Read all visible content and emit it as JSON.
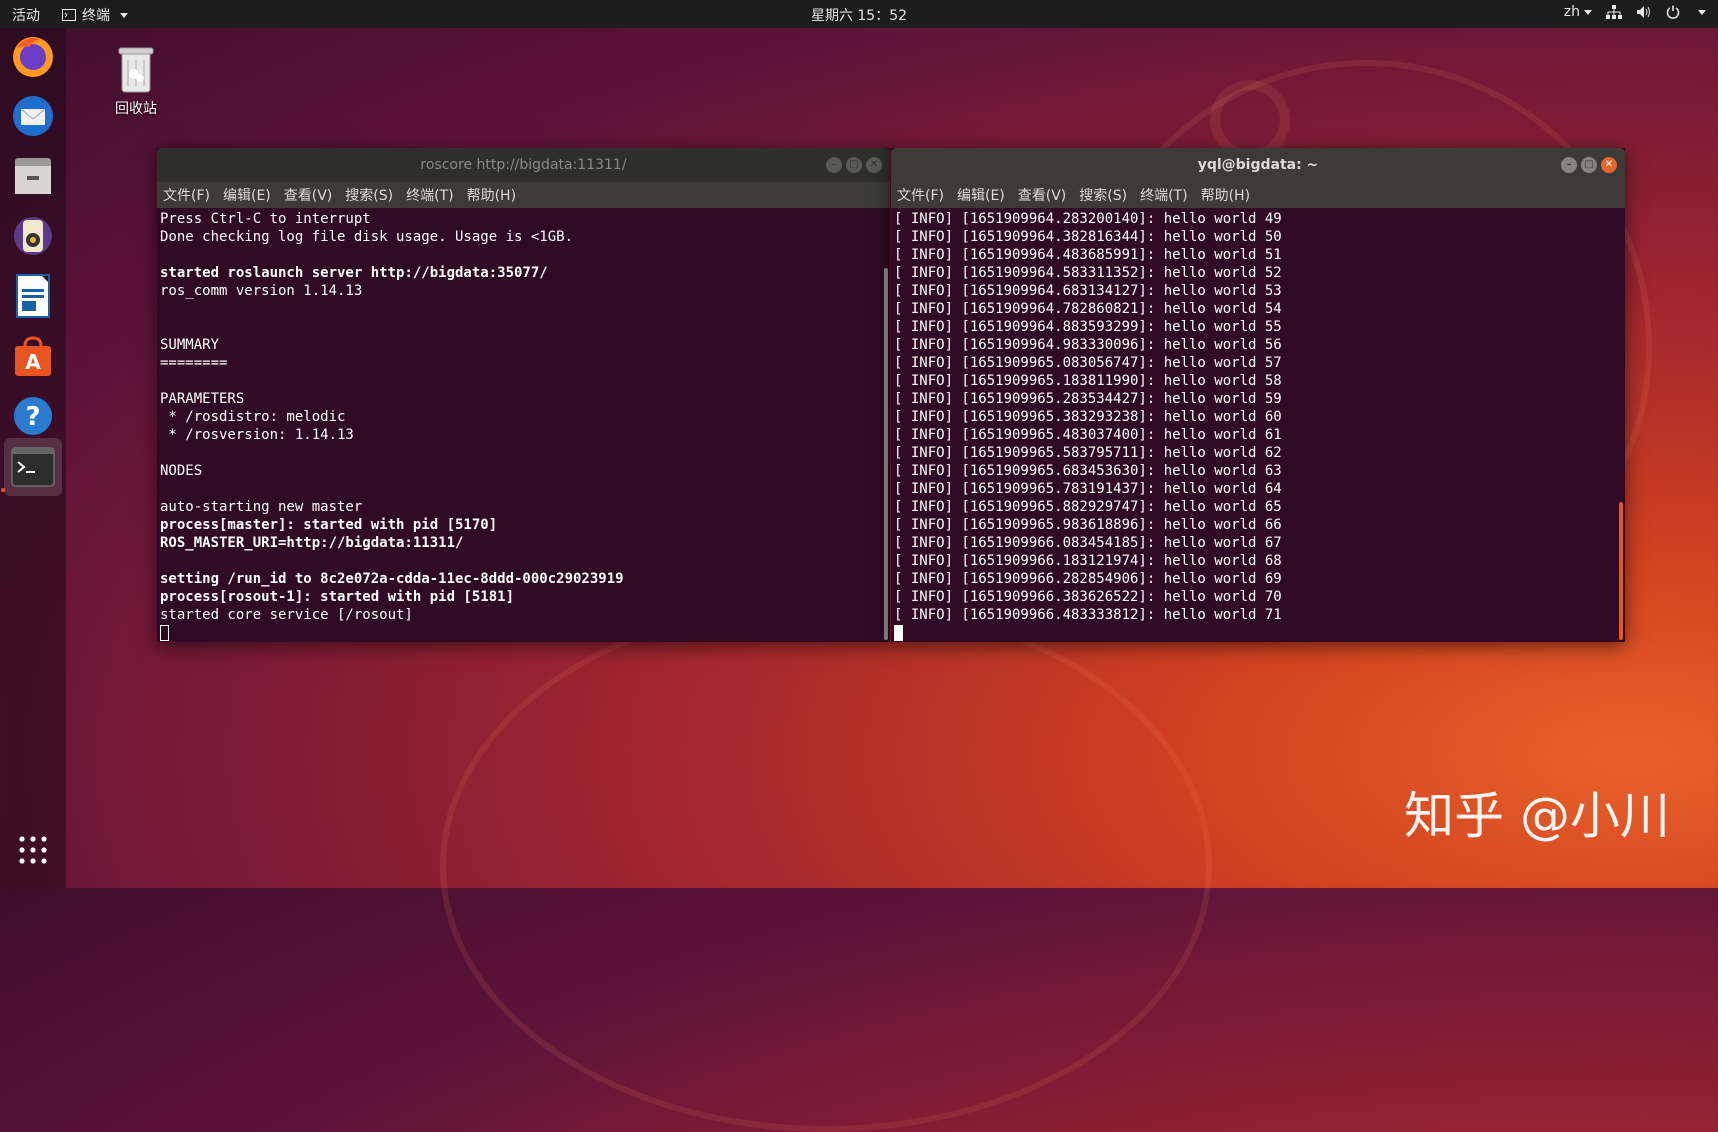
{
  "topbar": {
    "activities": "活动",
    "app_menu": "终端",
    "clock": "星期六 15：52",
    "lang": "zh"
  },
  "desktop": {
    "trash_label": "回收站"
  },
  "dock": {
    "items": [
      "firefox-icon",
      "thunderbird-icon",
      "files-icon",
      "rhythmbox-icon",
      "writer-icon",
      "software-icon",
      "help-icon",
      "terminal-icon"
    ],
    "show_apps": "show-applications-icon"
  },
  "window_left": {
    "title": "roscore http://bigdata:11311/",
    "menu": [
      "文件(F)",
      "编辑(E)",
      "查看(V)",
      "搜索(S)",
      "终端(T)",
      "帮助(H)"
    ],
    "lines": [
      {
        "text": "Press Ctrl-C to interrupt",
        "bold": false
      },
      {
        "text": "Done checking log file disk usage. Usage is <1GB.",
        "bold": false
      },
      {
        "text": "",
        "bold": false
      },
      {
        "text": "started roslaunch server http://bigdata:35077/",
        "bold": true
      },
      {
        "text": "ros_comm version 1.14.13",
        "bold": false
      },
      {
        "text": "",
        "bold": false
      },
      {
        "text": "",
        "bold": false
      },
      {
        "text": "SUMMARY",
        "bold": false
      },
      {
        "text": "========",
        "bold": false
      },
      {
        "text": "",
        "bold": false
      },
      {
        "text": "PARAMETERS",
        "bold": false
      },
      {
        "text": " * /rosdistro: melodic",
        "bold": false
      },
      {
        "text": " * /rosversion: 1.14.13",
        "bold": false
      },
      {
        "text": "",
        "bold": false
      },
      {
        "text": "NODES",
        "bold": false
      },
      {
        "text": "",
        "bold": false
      },
      {
        "text": "auto-starting new master",
        "bold": false
      },
      {
        "text": "process[master]: started with pid [5170]",
        "bold": true
      },
      {
        "text": "ROS_MASTER_URI=http://bigdata:11311/",
        "bold": true
      },
      {
        "text": "",
        "bold": false
      },
      {
        "text": "setting /run_id to 8c2e072a-cdda-11ec-8ddd-000c29023919",
        "bold": true
      },
      {
        "text": "process[rosout-1]: started with pid [5181]",
        "bold": true
      },
      {
        "text": "started core service [/rosout]",
        "bold": false
      }
    ]
  },
  "window_right": {
    "title": "yql@bigdata: ~",
    "menu": [
      "文件(F)",
      "编辑(E)",
      "查看(V)",
      "搜索(S)",
      "终端(T)",
      "帮助(H)"
    ],
    "lines": [
      "[ INFO] [1651909964.283200140]: hello world 49",
      "[ INFO] [1651909964.382816344]: hello world 50",
      "[ INFO] [1651909964.483685991]: hello world 51",
      "[ INFO] [1651909964.583311352]: hello world 52",
      "[ INFO] [1651909964.683134127]: hello world 53",
      "[ INFO] [1651909964.782860821]: hello world 54",
      "[ INFO] [1651909964.883593299]: hello world 55",
      "[ INFO] [1651909964.983330096]: hello world 56",
      "[ INFO] [1651909965.083056747]: hello world 57",
      "[ INFO] [1651909965.183811990]: hello world 58",
      "[ INFO] [1651909965.283534427]: hello world 59",
      "[ INFO] [1651909965.383293238]: hello world 60",
      "[ INFO] [1651909965.483037400]: hello world 61",
      "[ INFO] [1651909965.583795711]: hello world 62",
      "[ INFO] [1651909965.683453630]: hello world 63",
      "[ INFO] [1651909965.783191437]: hello world 64",
      "[ INFO] [1651909965.882929747]: hello world 65",
      "[ INFO] [1651909965.983618896]: hello world 66",
      "[ INFO] [1651909966.083454185]: hello world 67",
      "[ INFO] [1651909966.183121974]: hello world 68",
      "[ INFO] [1651909966.282854906]: hello world 69",
      "[ INFO] [1651909966.383626522]: hello world 70",
      "[ INFO] [1651909966.483333812]: hello world 71"
    ]
  },
  "watermark": "知乎 @小川",
  "colors": {
    "accent": "#e95420",
    "terminal_bg": "#300a24",
    "topbar": "#1d1d1d"
  }
}
